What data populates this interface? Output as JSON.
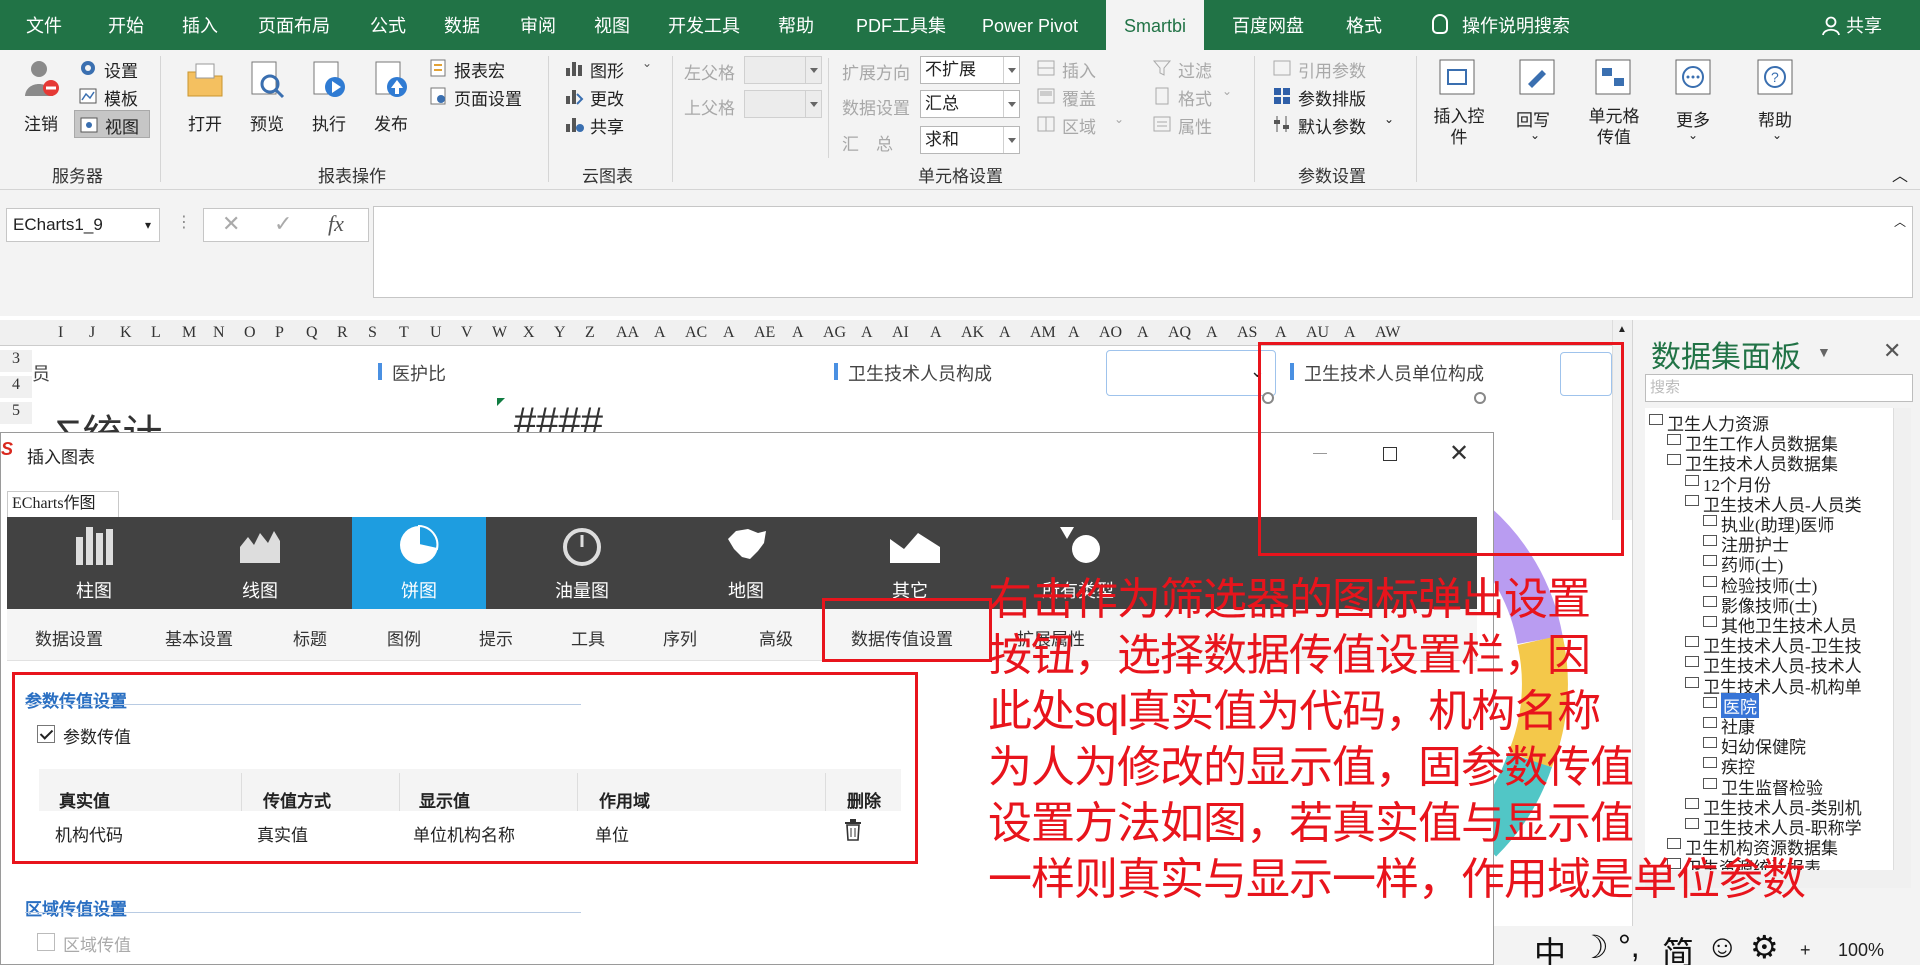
{
  "tabs": [
    "文件",
    "开始",
    "插入",
    "页面布局",
    "公式",
    "数据",
    "审阅",
    "视图",
    "开发工具",
    "帮助",
    "PDF工具集",
    "Power Pivot",
    "Smartbi",
    "百度网盘",
    "格式"
  ],
  "active_tab": "Smartbi",
  "tell_me": "操作说明搜索",
  "share": "共享",
  "ribbon": {
    "server": {
      "logout": "注销",
      "settings": "设置",
      "template": "模板",
      "view": "视图",
      "group": "服务器"
    },
    "report_ops": {
      "open": "打开",
      "preview": "预览",
      "execute": "执行",
      "publish": "发布",
      "report_macro": "报表宏",
      "page_setup": "页面设置",
      "group": "报表操作"
    },
    "cloud_chart": {
      "chart": "图形",
      "change": "更改",
      "share": "共享",
      "group": "云图表"
    },
    "cell_settings": {
      "left_parent": "左父格",
      "top_parent": "上父格",
      "expand_dir": "扩展方向",
      "expand_val": "不扩展",
      "data_setting": "数据设置",
      "data_val": "汇总",
      "summary_label": "汇　总",
      "summary_val": "求和",
      "insert": "插入",
      "cover": "覆盖",
      "region": "区域",
      "filter": "过滤",
      "format": "格式",
      "attr": "属性",
      "group": "单元格设置"
    },
    "param_settings": {
      "ref_param": "引用参数",
      "param_layout": "参数排版",
      "default_param": "默认参数",
      "group": "参数设置"
    },
    "insert_ctrl": "插入控件",
    "writeback": "回写",
    "cell_pass": "单元格传值",
    "more": "更多",
    "help": "帮助"
  },
  "name_box": "ECharts1_9",
  "columns": [
    "I",
    "J",
    "K",
    "L",
    "M",
    "N",
    "O",
    "P",
    "Q",
    "R",
    "S",
    "T",
    "U",
    "V",
    "W",
    "X",
    "Y",
    "Z",
    "AA",
    "A",
    "AC",
    "A",
    "AE",
    "A",
    "AG",
    "A",
    "AI",
    "A",
    "AK",
    "A",
    "AM",
    "A",
    "AO",
    "A",
    "AQ",
    "A",
    "AS",
    "A",
    "AU",
    "A",
    "AW"
  ],
  "rows": [
    "3",
    "4",
    "5"
  ],
  "sheet": {
    "frag1": "员",
    "title1": "医护比",
    "title2": "卫生技术人员构成",
    "title3": "卫生技术人员单位构成",
    "big1": "∑统计",
    "big2": "####"
  },
  "panel": {
    "title": "数据集面板",
    "search_placeholder": "搜索",
    "tree": [
      "卫生人力资源",
      "卫生工作人员数据集",
      "卫生技术人员数据集",
      "12个月份",
      "卫生技术人员-人员类",
      "执业(助理)医师",
      "注册护士",
      "药师(士)",
      "检验技师(士)",
      "影像技师(士)",
      "其他卫生技术人员",
      "卫生技术人员-卫生技",
      "卫生技术人员-技术人",
      "卫生技术人员-机构单",
      "医院",
      "社康",
      "妇幼保健院",
      "疾控",
      "卫生监督检验",
      "卫生技术人员-类别机",
      "卫生技术人员-职称学",
      "卫生机构资源数据集",
      "卫生资源统计报表"
    ],
    "tree_selected": "医院"
  },
  "dialog": {
    "title": "插入图表",
    "subtab": "ECharts作图",
    "chart_types": [
      "柱图",
      "线图",
      "饼图",
      "油量图",
      "地图",
      "其它",
      "所有类型"
    ],
    "active_type": "饼图",
    "setting_tabs": [
      "数据设置",
      "基本设置",
      "标题",
      "图例",
      "提示",
      "工具",
      "序列",
      "高级",
      "数据传值设置",
      "扩展属性"
    ],
    "active_setting": "数据传值设置",
    "param_section": "参数传值设置",
    "param_check": "参数传值",
    "param_checked": true,
    "table_headers": [
      "真实值",
      "传值方式",
      "显示值",
      "作用域",
      "删除"
    ],
    "table_row": [
      "机构代码",
      "真实值",
      "单位机构名称",
      "单位"
    ],
    "region_section": "区域传值设置",
    "region_check": "区域传值",
    "region_checked": false
  },
  "annotation": [
    "右击作为筛选器的图标弹出设置",
    "按钮，选择数据传值设置栏，因",
    "此处sql真实值为代码，机构名称",
    "为人为修改的显示值，固参数传值",
    "设置方法如图，若真实值与显示值",
    "一样则真实与显示一样，作用域是单位参数"
  ],
  "status": {
    "ime_mode": "中",
    "punct": "°,",
    "simplified": "简",
    "zoom": "100%",
    "zoom_plus": "+"
  },
  "colors": {
    "excel_green": "#217346",
    "annotation_red": "#e8141c",
    "chart_active_blue": "#1e9de0",
    "chart_bar_dark": "#424242"
  }
}
